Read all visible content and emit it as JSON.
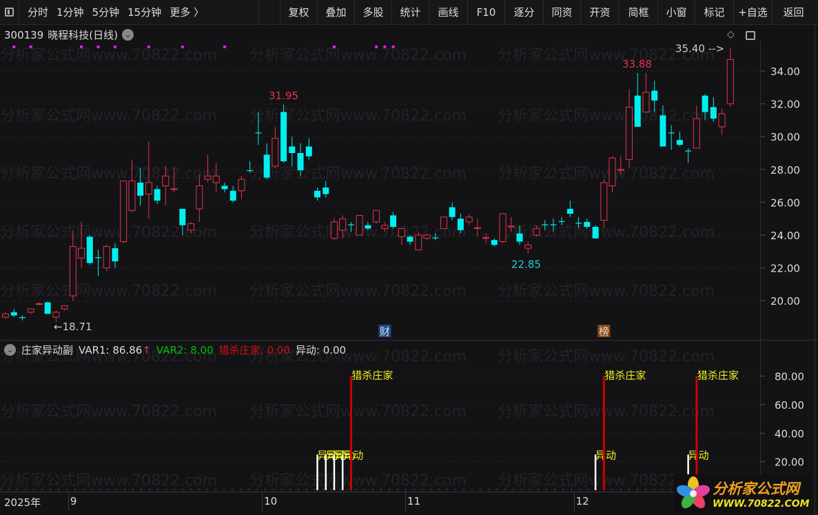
{
  "toolbar": {
    "periods": [
      "分时",
      "1分钟",
      "5分钟",
      "15分钟",
      "更多 〉"
    ],
    "buttons": [
      "复权",
      "叠加",
      "多股",
      "统计",
      "画线",
      "F10",
      "逐分",
      "同资",
      "开资",
      "简框",
      "小窗",
      "标记",
      "+自选",
      "返回"
    ]
  },
  "stock": {
    "code": "300139",
    "name": "晓程科技",
    "period": "(日线)"
  },
  "watermark": "分析家公式网www.70822.com",
  "logo": {
    "title": "分析家公式网",
    "url": "WWW.70822.COM"
  },
  "markers": {
    "cai": "财",
    "bang": "榜"
  },
  "sub": {
    "title": "庄家异动副",
    "var1_label": "VAR1: 86.86",
    "var1_arrow": "↑",
    "var2_label": "VAR2: 8.00",
    "lieshashuang_label": "猎杀庄家: 0.00",
    "yidong_label": "异动: 0.00",
    "signal_big": "猎杀庄家",
    "signal_small": "异动"
  },
  "colors": {
    "up": "#e8334a",
    "down": "#00f0f0",
    "bg": "#131316",
    "red_line": "#d00000",
    "yellow": "#f0f020",
    "var2": "#00c000"
  },
  "chart_data": [
    {
      "type": "candlestick",
      "title": "300139 晓程科技(日线)",
      "ylim": [
        18.0,
        35.6
      ],
      "y_ticks": [
        "34.00",
        "32.00",
        "30.00",
        "28.00",
        "26.00",
        "24.00",
        "22.00",
        "20.00"
      ],
      "annotations": {
        "high": "35.40",
        "high_arrow": "35.40 -->",
        "peak1": "31.95",
        "peak2": "33.88",
        "low1": "22.85",
        "low0": "←18.71"
      },
      "ohlc": [
        [
          19.0,
          19.3,
          18.9,
          19.2
        ],
        [
          19.3,
          19.5,
          19.0,
          19.1
        ],
        [
          19.0,
          19.1,
          18.8,
          18.95
        ],
        [
          19.3,
          19.5,
          19.2,
          19.5
        ],
        [
          19.8,
          19.9,
          19.7,
          19.82
        ],
        [
          19.9,
          19.95,
          19.2,
          19.2
        ],
        [
          19.0,
          19.4,
          18.71,
          19.3
        ],
        [
          19.5,
          19.7,
          19.4,
          19.7
        ],
        [
          20.3,
          24.3,
          20.0,
          23.3
        ],
        [
          22.6,
          24.8,
          22.0,
          23.2
        ],
        [
          23.9,
          24.0,
          22.2,
          22.3
        ],
        [
          22.65,
          23.1,
          21.5,
          22.6
        ],
        [
          22.0,
          23.4,
          21.8,
          23.3
        ],
        [
          23.2,
          23.5,
          22.0,
          22.4
        ],
        [
          23.6,
          27.3,
          23.5,
          27.3
        ],
        [
          25.5,
          28.6,
          25.4,
          27.3
        ],
        [
          27.2,
          28.1,
          25.8,
          26.4
        ],
        [
          26.5,
          29.7,
          25.0,
          27.2
        ],
        [
          26.8,
          27.0,
          25.9,
          26.1
        ],
        [
          27.0,
          28.2,
          25.8,
          27.6
        ],
        [
          26.8,
          28.1,
          26.6,
          26.82
        ],
        [
          25.6,
          25.6,
          24.0,
          24.6
        ],
        [
          24.3,
          24.8,
          24.1,
          24.7
        ],
        [
          25.6,
          27.7,
          24.8,
          27.0
        ],
        [
          27.4,
          28.9,
          27.2,
          27.6
        ],
        [
          27.2,
          28.4,
          26.6,
          27.6
        ],
        [
          27.0,
          27.2,
          26.6,
          26.8
        ],
        [
          26.7,
          27.0,
          26.0,
          26.1
        ],
        [
          26.7,
          27.6,
          26.2,
          27.4
        ],
        [
          27.95,
          28.5,
          27.8,
          27.9
        ],
        [
          30.25,
          31.5,
          29.5,
          30.2
        ],
        [
          28.9,
          29.6,
          27.4,
          27.5
        ],
        [
          28.2,
          30.6,
          28.1,
          29.9
        ],
        [
          31.5,
          31.95,
          28.4,
          28.5
        ],
        [
          29.4,
          30.0,
          28.2,
          29.0
        ],
        [
          29.0,
          29.6,
          27.6,
          27.95
        ],
        [
          29.4,
          29.9,
          28.6,
          28.8
        ],
        [
          26.7,
          26.9,
          26.1,
          26.3
        ],
        [
          26.9,
          27.3,
          26.3,
          26.5
        ],
        [
          23.8,
          25.0,
          23.7,
          24.8
        ],
        [
          24.3,
          25.2,
          23.8,
          25.0
        ],
        [
          24.65,
          24.8,
          24.2,
          24.6
        ],
        [
          24.0,
          25.2,
          24.0,
          25.2
        ],
        [
          24.6,
          24.8,
          24.3,
          24.4
        ],
        [
          24.8,
          25.5,
          24.7,
          25.5
        ],
        [
          24.4,
          24.8,
          24.2,
          24.6
        ],
        [
          25.2,
          25.4,
          24.4,
          24.5
        ],
        [
          23.9,
          24.4,
          23.4,
          24.4
        ],
        [
          23.9,
          24.0,
          23.4,
          23.6
        ],
        [
          23.1,
          24.2,
          23.1,
          24.0
        ],
        [
          23.8,
          24.1,
          23.7,
          24.0
        ],
        [
          23.85,
          24.1,
          23.7,
          23.8
        ],
        [
          24.4,
          25.1,
          24.4,
          25.1
        ],
        [
          25.7,
          26.0,
          24.9,
          25.1
        ],
        [
          25.0,
          25.3,
          24.1,
          24.3
        ],
        [
          24.8,
          25.3,
          24.6,
          25.1
        ],
        [
          24.4,
          25.0,
          23.9,
          24.45
        ],
        [
          23.8,
          24.1,
          23.5,
          23.85
        ],
        [
          23.7,
          23.8,
          23.3,
          23.4
        ],
        [
          23.6,
          25.3,
          23.5,
          25.3
        ],
        [
          24.5,
          25.1,
          24.2,
          24.55
        ],
        [
          24.1,
          24.6,
          23.4,
          23.6
        ],
        [
          23.2,
          23.6,
          22.85,
          23.4
        ],
        [
          24.0,
          24.6,
          23.9,
          24.4
        ],
        [
          24.65,
          24.9,
          24.3,
          24.6
        ],
        [
          24.65,
          25.0,
          24.2,
          24.6
        ],
        [
          24.85,
          25.1,
          24.6,
          24.8
        ],
        [
          25.6,
          26.1,
          25.1,
          25.3
        ],
        [
          24.75,
          25.1,
          24.4,
          24.7
        ],
        [
          24.8,
          25.0,
          24.4,
          24.5
        ],
        [
          24.5,
          24.6,
          23.8,
          23.8
        ],
        [
          24.9,
          27.4,
          24.4,
          27.2
        ],
        [
          27.0,
          28.8,
          26.6,
          28.7
        ],
        [
          27.95,
          28.8,
          27.7,
          28.0
        ],
        [
          28.6,
          32.9,
          28.1,
          31.8
        ],
        [
          32.5,
          33.88,
          30.6,
          30.6
        ],
        [
          31.5,
          33.88,
          31.5,
          32.7
        ],
        [
          32.8,
          33.4,
          31.5,
          32.2
        ],
        [
          31.3,
          31.9,
          29.4,
          29.4
        ],
        [
          30.25,
          30.7,
          29.2,
          30.2
        ],
        [
          29.8,
          30.3,
          29.4,
          29.5
        ],
        [
          29.15,
          29.3,
          28.4,
          29.1
        ],
        [
          29.3,
          31.9,
          29.3,
          31.1
        ],
        [
          32.5,
          32.6,
          31.0,
          31.5
        ],
        [
          31.8,
          32.4,
          30.9,
          31.1
        ],
        [
          30.6,
          31.7,
          30.1,
          31.4
        ],
        [
          32.0,
          35.4,
          31.8,
          34.7
        ]
      ],
      "event_bars": [
        1,
        3,
        9,
        11,
        13,
        17,
        21,
        26,
        39,
        44,
        45,
        46
      ],
      "marker_bars": {
        "cai": 45,
        "bang": 71
      }
    },
    {
      "type": "bar",
      "title": "庄家异动副",
      "ylim": [
        0,
        90
      ],
      "y_ticks": [
        "80.00",
        "60.00",
        "40.00",
        "20.00"
      ],
      "yidong_bars": [
        {
          "bar": 37,
          "value": 25
        },
        {
          "bar": 38,
          "value": 25
        },
        {
          "bar": 39,
          "value": 25
        },
        {
          "bar": 40,
          "value": 25
        },
        {
          "bar": 70,
          "value": 25
        },
        {
          "bar": 81,
          "value": 25
        }
      ],
      "lieshazhuangjia_bars": [
        {
          "bar": 41,
          "value": 80
        },
        {
          "bar": 71,
          "value": 80
        },
        {
          "bar": 82,
          "value": 80
        }
      ]
    }
  ],
  "date_axis": {
    "year": "2025年",
    "months": [
      {
        "label": "9",
        "bar": 8
      },
      {
        "label": "10",
        "bar": 31
      },
      {
        "label": "11",
        "bar": 48
      },
      {
        "label": "12",
        "bar": 68
      }
    ]
  }
}
